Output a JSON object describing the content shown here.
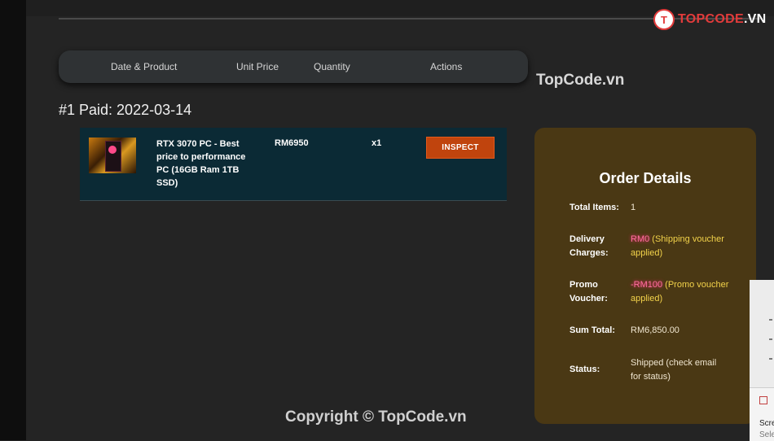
{
  "logo": {
    "mark": "T",
    "text_brand": "TOPCODE",
    "text_domain": ".VN"
  },
  "header": {
    "col_date_product": "Date & Product",
    "col_unit_price": "Unit Price",
    "col_quantity": "Quantity",
    "col_actions": "Actions"
  },
  "watermark_top": "TopCode.vn",
  "watermark_bottom": "Copyright © TopCode.vn",
  "order": {
    "heading": "#1 Paid: 2022-03-14",
    "item": {
      "name": "RTX 3070 PC - Best price to performance PC (16GB Ram 1TB SSD)",
      "price": "RM6950",
      "quantity": "x1",
      "action_label": "INSPECT"
    }
  },
  "details": {
    "title": "Order Details",
    "total_items_label": "Total Items:",
    "total_items_value": "1",
    "delivery_label": "Delivery Charges:",
    "delivery_amount": "RM0",
    "delivery_note": " (Shipping voucher applied)",
    "promo_label": "Promo Voucher:",
    "promo_amount": "-RM100",
    "promo_note": " (Promo voucher applied)",
    "sum_label": "Sum Total:",
    "sum_value": "RM6,850.00",
    "status_label": "Status:",
    "status_value": "Shipped (check email for status)"
  },
  "side_popup": {
    "line1": "Scre",
    "line2": "Sele"
  },
  "colors": {
    "background": "#242424",
    "item_card": "#0b2a35",
    "details_card": "#4a3814",
    "inspect_button": "#c0440d",
    "highlight_pink": "#ff6ea0",
    "note_yellow": "#f2d24a"
  },
  "icons": {
    "logo": "topcode-logo-icon",
    "popup": "screenshot-tool-icon"
  }
}
